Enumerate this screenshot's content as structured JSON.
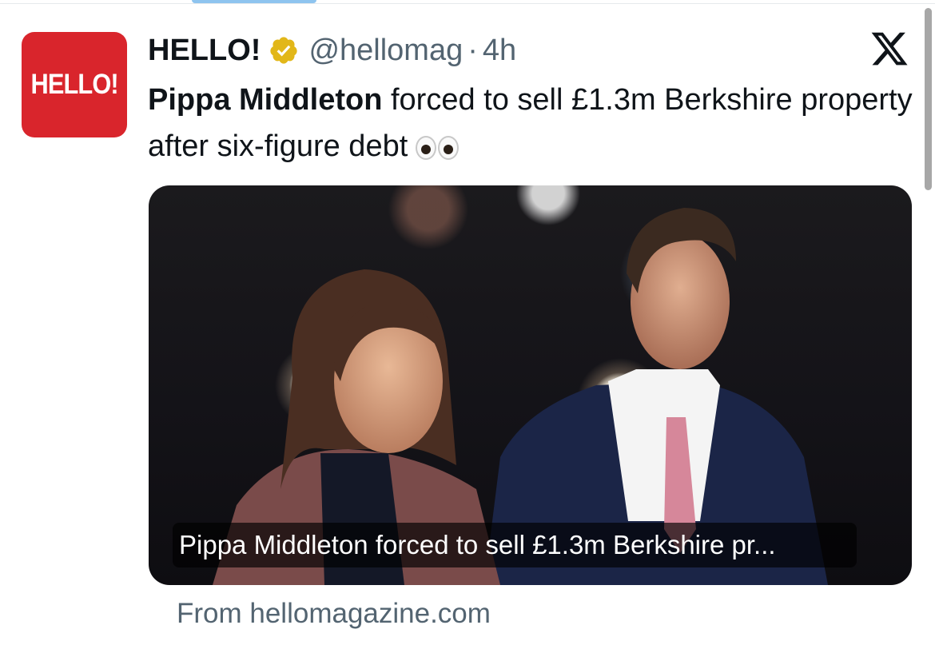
{
  "author": {
    "avatar_text": "HELLO!",
    "name": "HELLO!",
    "handle": "@hellomag",
    "separator": "·",
    "time": "4h"
  },
  "tweet": {
    "bold_text": "Pippa Middleton",
    "text": " forced to sell £1.3m Berkshire property after six-figure debt"
  },
  "card": {
    "caption": "Pippa Middleton forced to sell £1.3m Berkshire pr...",
    "source": "From hellomagazine.com"
  },
  "colors": {
    "avatar_bg": "#d9252c",
    "verified_gold": "#e2b719",
    "secondary_text": "#536471"
  },
  "icons": {
    "verified": "verified-badge-icon",
    "platform": "x-logo-icon",
    "emoji": "eyes-emoji-icon"
  }
}
